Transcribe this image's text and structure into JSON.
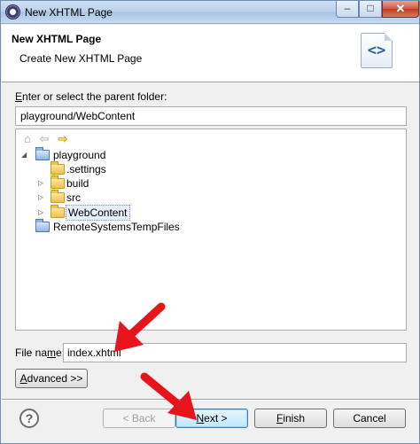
{
  "window": {
    "title": "New XHTML Page",
    "minimize_label": "–",
    "maximize_label": "□",
    "close_label": "✕"
  },
  "header": {
    "title": "New XHTML Page",
    "subtitle": "Create New XHTML Page",
    "icon_glyph": "<>"
  },
  "parent_folder": {
    "label": "Enter or select the parent folder:",
    "value": "playground/WebContent",
    "nav": {
      "home": "⌂",
      "back": "⇦",
      "forward": "⇨"
    },
    "tree": [
      {
        "label": "playground",
        "twisty": "◢",
        "type": "project"
      },
      {
        "label": ".settings",
        "twisty": "",
        "type": "folder"
      },
      {
        "label": "build",
        "twisty": "▷",
        "type": "folder"
      },
      {
        "label": "src",
        "twisty": "▷",
        "type": "folder"
      },
      {
        "label": "WebContent",
        "twisty": "▷",
        "type": "folder",
        "selected": true
      },
      {
        "label": "RemoteSystemsTempFiles",
        "twisty": "",
        "type": "project"
      }
    ]
  },
  "file": {
    "label": "File name:",
    "value": "index.xhtml"
  },
  "buttons": {
    "advanced": "Advanced >>",
    "help": "?",
    "back": "< Back",
    "next": "Next >",
    "finish": "Finish",
    "cancel": "Cancel"
  },
  "annotation_color": "#e8141c"
}
